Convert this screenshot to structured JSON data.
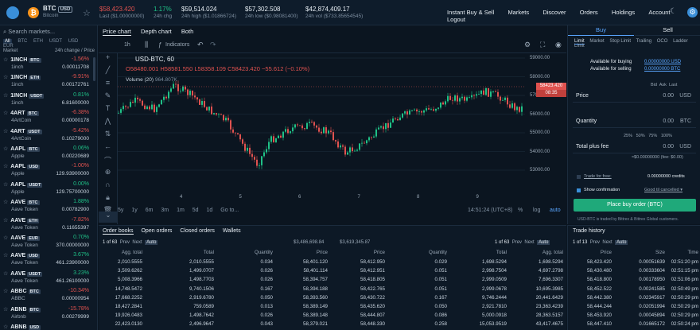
{
  "header": {
    "pair": "BTC",
    "currency": "USD",
    "coin_name": "Bitcoin",
    "last_price": "$58,423.420",
    "last_label": "Last ($1.00000000)",
    "change_pct": "1.17%",
    "change_label": "24h chg",
    "high": "$59,514.024",
    "high_label": "24h high ($1.01866724)",
    "low": "$57,302.508",
    "low_label": "24h low ($0.98081400)",
    "vol": "$42,874,409.17",
    "vol_label": "24h vol ($733.85654545)",
    "nav": [
      "Instant Buy & Sell",
      "Markets",
      "Discover",
      "Orders",
      "Holdings",
      "Account",
      "Logout"
    ]
  },
  "sidebar": {
    "search_placeholder": "Search markets...",
    "filters": [
      "All",
      "BTC",
      "ETH",
      "USDT",
      "USD",
      "EUR"
    ],
    "col_market": "Market",
    "col_change": "24h change / Price",
    "markets": [
      {
        "sym": "1INCH",
        "cur": "BTC",
        "name": "1inch",
        "chg": "-1.56%",
        "price": "0.00011708",
        "up": false
      },
      {
        "sym": "1INCH",
        "cur": "ETH",
        "name": "1inch",
        "chg": "-9.91%",
        "price": "0.00172761",
        "up": false
      },
      {
        "sym": "1INCH",
        "cur": "USDT",
        "name": "1inch",
        "chg": "0.81%",
        "price": "6.81600000",
        "up": true
      },
      {
        "sym": "4ART",
        "cur": "BTC",
        "name": "4ArtCoin",
        "chg": "-6.38%",
        "price": "0.00000178",
        "up": false
      },
      {
        "sym": "4ART",
        "cur": "USDT",
        "name": "4ArtCoin",
        "chg": "-5.42%",
        "price": "0.10279000",
        "up": false
      },
      {
        "sym": "AAPL",
        "cur": "BTC",
        "name": "Apple",
        "chg": "0.06%",
        "price": "0.00220689",
        "up": true
      },
      {
        "sym": "AAPL",
        "cur": "USD",
        "name": "Apple",
        "chg": "-1.00%",
        "price": "129.93900000",
        "up": false
      },
      {
        "sym": "AAPL",
        "cur": "USDT",
        "name": "Apple",
        "chg": "0.00%",
        "price": "129.75700000",
        "up": true
      },
      {
        "sym": "AAVE",
        "cur": "BTC",
        "name": "Aave Token",
        "chg": "1.88%",
        "price": "0.00782900",
        "up": true
      },
      {
        "sym": "AAVE",
        "cur": "ETH",
        "name": "Aave Token",
        "chg": "-7.82%",
        "price": "0.11655397",
        "up": false
      },
      {
        "sym": "AAVE",
        "cur": "EUR",
        "name": "Aave Token",
        "chg": "0.70%",
        "price": "370.00000000",
        "up": true
      },
      {
        "sym": "AAVE",
        "cur": "USD",
        "name": "Aave Token",
        "chg": "3.67%",
        "price": "461.23900000",
        "up": true
      },
      {
        "sym": "AAVE",
        "cur": "USDT",
        "name": "Aave Token",
        "chg": "3.23%",
        "price": "461.26100000",
        "up": true
      },
      {
        "sym": "ABBC",
        "cur": "BTC",
        "name": "ABBC",
        "chg": "-10.34%",
        "price": "0.00000954",
        "up": false
      },
      {
        "sym": "ABNB",
        "cur": "BTC",
        "name": "Airbnb",
        "chg": "-15.78%",
        "price": "0.00279999",
        "up": false
      },
      {
        "sym": "ABNB",
        "cur": "USD",
        "name": "Airbnb",
        "chg": "",
        "price": "",
        "up": false
      }
    ]
  },
  "chart": {
    "tabs": [
      "Price chart",
      "Depth chart",
      "Both"
    ],
    "interval": "1h",
    "indicators": "Indicators",
    "symbol": "USD-BTC, 60",
    "ohlc": {
      "o": "O58480.001",
      "h": "H58581.550",
      "l": "L58358.109",
      "c": "C58423.420",
      "chg": "−55.612 (−0.10%)"
    },
    "volume_label": "Volume (20)",
    "volume_val": "964.807K",
    "price_tag": "58423.420",
    "time_tag": "08:35",
    "y_ticks": [
      "59000.00",
      "58000.00",
      "57000.00",
      "56000.00",
      "55000.00",
      "54000.00",
      "53000.00"
    ],
    "x_ticks": [
      "4",
      "5",
      "6",
      "7",
      "8",
      "9"
    ],
    "ranges": [
      "5y",
      "1y",
      "6m",
      "3m",
      "1m",
      "5d",
      "1d",
      "Go to..."
    ],
    "clock": "14:51:24 (UTC+8)",
    "scale": [
      "%",
      "log",
      "auto"
    ]
  },
  "order": {
    "tabs": [
      "Buy",
      "Sell"
    ],
    "types": [
      "Limit",
      "Market",
      "Stop Limit",
      "Trailing",
      "OCO",
      "Ladder Limit"
    ],
    "avail_buy_label": "Available for buying",
    "avail_buy": "0.00000000 USD",
    "avail_sell_label": "Available for selling",
    "avail_sell": "0.00000000 BTC",
    "book_opts": [
      "Bid",
      "Ask",
      "Last"
    ],
    "price_label": "Price",
    "price_val": "0.00",
    "price_cur": "USD",
    "qty_label": "Quantity",
    "qty_val": "0.00",
    "qty_cur": "BTC",
    "pcts": [
      "25%",
      "50%",
      "75%",
      "100%"
    ],
    "total_label": "Total plus fee",
    "total_val": "0.00",
    "total_cur": "USD",
    "fee_note": "≈$0.00000000 (fee: $0.00)",
    "free_label": "Trade for free:",
    "credits": "0.00000000 credits",
    "confirm": "Show confirmation",
    "gtc": "Good til cancelled ▾",
    "button": "Place buy order (BTC)",
    "disclaimer": "USD-BTC is traded by Bittrex & Bittrex Global customers."
  },
  "books": {
    "tabs": [
      "Order books",
      "Open orders",
      "Closed orders",
      "Wallets"
    ],
    "page": "1 of 63",
    "prev": "Prev",
    "next": "Next",
    "auto": "Auto",
    "sum_bid": "$3,486,698.84",
    "sum_ask": "$3,619,345.87",
    "headers": [
      "Agg. total",
      "Total",
      "Quantity",
      "Price",
      "Price",
      "Quantity",
      "Total",
      "Agg. total"
    ],
    "rows": [
      [
        "2,010.5555",
        "2,010.5555",
        "0.034",
        "58,401.120",
        "58,412.950",
        "0.029",
        "1,698.5294",
        "1,698.5294"
      ],
      [
        "3,509.6262",
        "1,499.0707",
        "0.026",
        "58,401.114",
        "58,412.951",
        "0.051",
        "2,998.7504",
        "4,697.2798"
      ],
      [
        "5,008.3966",
        "1,498.7703",
        "0.026",
        "58,394.757",
        "58,418.805",
        "0.051",
        "2,999.0509",
        "7,696.3307"
      ],
      [
        "14,748.5472",
        "9,740.1506",
        "0.167",
        "58,394.188",
        "58,422.765",
        "0.051",
        "2,999.0678",
        "10,695.3985"
      ],
      [
        "17,668.2252",
        "2,919.6780",
        "0.050",
        "58,393.560",
        "58,430.722",
        "0.167",
        "9,746.2444",
        "20,441.6429"
      ],
      [
        "18,427.2841",
        "759.0589",
        "0.013",
        "58,389.149",
        "58,435.620",
        "0.050",
        "2,921.7810",
        "23,363.4239"
      ],
      [
        "19,926.0483",
        "1,498.7642",
        "0.026",
        "58,389.148",
        "58,444.807",
        "0.086",
        "5,000.0918",
        "28,363.5157"
      ],
      [
        "22,423.0130",
        "2,496.9647",
        "0.043",
        "58,379.021",
        "58,448.330",
        "0.258",
        "15,053.9519",
        "43,417.4675"
      ]
    ]
  },
  "trades": {
    "title": "Trade history",
    "page": "1 of 13",
    "prev": "Prev",
    "next": "Next",
    "auto": "Auto",
    "headers": [
      "Price",
      "Size",
      "Time"
    ],
    "rows": [
      [
        "58,423.420",
        "0.00051639",
        "02:51:20 pm",
        true
      ],
      [
        "58,430.480",
        "0.00333604",
        "02:51:15 pm",
        false
      ],
      [
        "58,418.800",
        "0.00178950",
        "02:51:06 pm",
        false
      ],
      [
        "58,452.522",
        "0.00241585",
        "02:50:49 pm",
        true
      ],
      [
        "58,442.380",
        "0.02345917",
        "02:50:29 pm",
        false
      ],
      [
        "58,444.244",
        "0.02051994",
        "02:50:29 pm",
        false
      ],
      [
        "58,453.920",
        "0.00045894",
        "02:50:29 pm",
        true
      ],
      [
        "58,447.410",
        "0.01665172",
        "02:50:24 pm",
        false
      ]
    ]
  },
  "colors": {
    "up": "#1fc187",
    "down": "#e0524f",
    "accent": "#5aa6ff",
    "bg": "#0b1520"
  }
}
